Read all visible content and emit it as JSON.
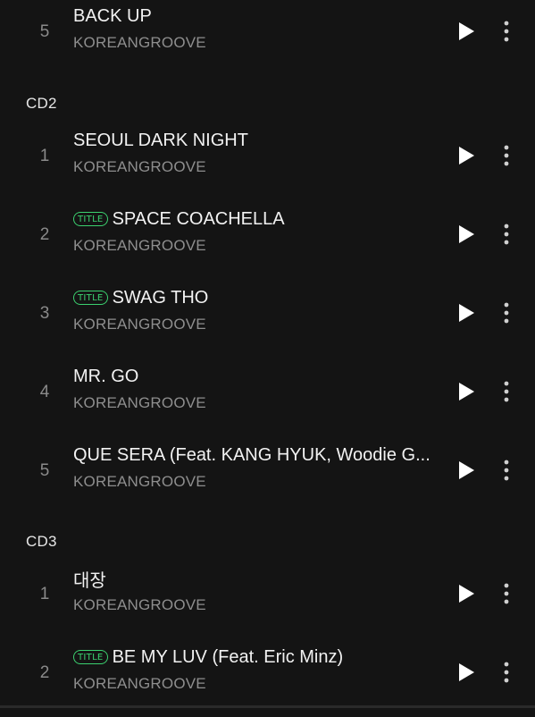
{
  "sections": [
    {
      "header": "",
      "tracks": [
        {
          "number": "5",
          "title": "BACK UP",
          "artist": "KOREANGROOVE",
          "is_title": false
        }
      ]
    },
    {
      "header": "CD2",
      "tracks": [
        {
          "number": "1",
          "title": "SEOUL DARK NIGHT",
          "artist": "KOREANGROOVE",
          "is_title": false
        },
        {
          "number": "2",
          "title": "SPACE COACHELLA",
          "artist": "KOREANGROOVE",
          "is_title": true
        },
        {
          "number": "3",
          "title": "SWAG THO",
          "artist": "KOREANGROOVE",
          "is_title": true
        },
        {
          "number": "4",
          "title": "MR. GO",
          "artist": "KOREANGROOVE",
          "is_title": false
        },
        {
          "number": "5",
          "title": "QUE SERA (Feat. KANG HYUK, Woodie G...",
          "artist": "KOREANGROOVE",
          "is_title": false
        }
      ]
    },
    {
      "header": "CD3",
      "tracks": [
        {
          "number": "1",
          "title": "대장",
          "artist": "KOREANGROOVE",
          "is_title": false
        },
        {
          "number": "2",
          "title": "BE MY LUV (Feat. Eric Minz)",
          "artist": "KOREANGROOVE",
          "is_title": true
        }
      ]
    }
  ],
  "badge_label": "TITLE",
  "icons": {
    "play": "play-icon",
    "more": "more-vertical-icon"
  },
  "colors": {
    "background": "#141414",
    "badge": "#3bd16f",
    "secondary_text": "#8e8e8e"
  }
}
